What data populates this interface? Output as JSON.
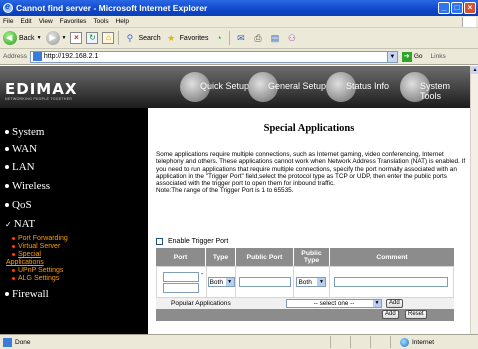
{
  "window": {
    "title": "Cannot find server - Microsoft Internet Explorer"
  },
  "menu": [
    "File",
    "Edit",
    "View",
    "Favorites",
    "Tools",
    "Help"
  ],
  "toolbar": {
    "back": "Back",
    "search": "Search",
    "favorites": "Favorites"
  },
  "address": {
    "label": "Address",
    "url": "http://192.168.2.1",
    "go": "Go",
    "links": "Links"
  },
  "banner": {
    "logo": "EDIMAX",
    "tagline": "NETWORKING PEOPLE TOGETHER",
    "nav": [
      "Quick Setup",
      "General Setup",
      "Status Info",
      "System Tools"
    ]
  },
  "sidebar": {
    "items": [
      "System",
      "WAN",
      "LAN",
      "Wireless",
      "QoS",
      "NAT",
      "Firewall"
    ],
    "nat_sub": [
      "Port Forwarding",
      "Virtual Server",
      "Special",
      "Applications",
      "UPnP Settings",
      "ALG Settings"
    ]
  },
  "main": {
    "title": "Special Applications",
    "description": "Some applications require multiple connections, such as Internet gaming, video conferencing, Internet telephony and others. These applications cannot work when Network Address Translation (NAT) is enabled. If you need to run applications that require multiple connections, specify the port normally associated with an application in the \"Trigger Port\" field,select the protocol type as TCP or UDP, then enter the public ports associated with the trigger port to open them for inbound traffic.",
    "note": "Note:The range of the Trigger Port is 1 to 65535.",
    "enable_trigger": "Enable Trigger Port",
    "enable_trigger_checked": false,
    "table": {
      "headers": [
        "Port",
        "Type",
        "Public Port",
        "Public Type",
        "Comment"
      ],
      "row": {
        "type": "Both",
        "public_type": "Both",
        "port_sep": "-"
      }
    },
    "popular_label": "Popular Applications",
    "popular_select": "-- select one --",
    "add_label": "Add",
    "reset_label": "Reset"
  },
  "status": {
    "left": "Done",
    "zone": "Internet"
  }
}
